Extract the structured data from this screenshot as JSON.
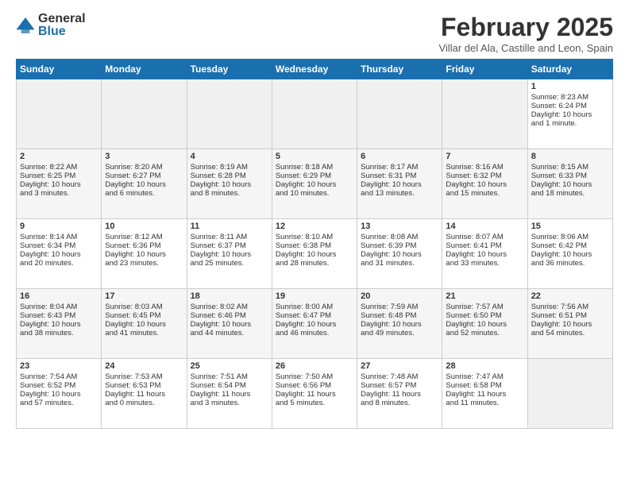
{
  "header": {
    "logo_general": "General",
    "logo_blue": "Blue",
    "month_year": "February 2025",
    "location": "Villar del Ala, Castille and Leon, Spain"
  },
  "days_of_week": [
    "Sunday",
    "Monday",
    "Tuesday",
    "Wednesday",
    "Thursday",
    "Friday",
    "Saturday"
  ],
  "weeks": [
    [
      {
        "day": "",
        "info": ""
      },
      {
        "day": "",
        "info": ""
      },
      {
        "day": "",
        "info": ""
      },
      {
        "day": "",
        "info": ""
      },
      {
        "day": "",
        "info": ""
      },
      {
        "day": "",
        "info": ""
      },
      {
        "day": "1",
        "info": "Sunrise: 8:23 AM\nSunset: 6:24 PM\nDaylight: 10 hours\nand 1 minute."
      }
    ],
    [
      {
        "day": "2",
        "info": "Sunrise: 8:22 AM\nSunset: 6:25 PM\nDaylight: 10 hours\nand 3 minutes."
      },
      {
        "day": "3",
        "info": "Sunrise: 8:20 AM\nSunset: 6:27 PM\nDaylight: 10 hours\nand 6 minutes."
      },
      {
        "day": "4",
        "info": "Sunrise: 8:19 AM\nSunset: 6:28 PM\nDaylight: 10 hours\nand 8 minutes."
      },
      {
        "day": "5",
        "info": "Sunrise: 8:18 AM\nSunset: 6:29 PM\nDaylight: 10 hours\nand 10 minutes."
      },
      {
        "day": "6",
        "info": "Sunrise: 8:17 AM\nSunset: 6:31 PM\nDaylight: 10 hours\nand 13 minutes."
      },
      {
        "day": "7",
        "info": "Sunrise: 8:16 AM\nSunset: 6:32 PM\nDaylight: 10 hours\nand 15 minutes."
      },
      {
        "day": "8",
        "info": "Sunrise: 8:15 AM\nSunset: 6:33 PM\nDaylight: 10 hours\nand 18 minutes."
      }
    ],
    [
      {
        "day": "9",
        "info": "Sunrise: 8:14 AM\nSunset: 6:34 PM\nDaylight: 10 hours\nand 20 minutes."
      },
      {
        "day": "10",
        "info": "Sunrise: 8:12 AM\nSunset: 6:36 PM\nDaylight: 10 hours\nand 23 minutes."
      },
      {
        "day": "11",
        "info": "Sunrise: 8:11 AM\nSunset: 6:37 PM\nDaylight: 10 hours\nand 25 minutes."
      },
      {
        "day": "12",
        "info": "Sunrise: 8:10 AM\nSunset: 6:38 PM\nDaylight: 10 hours\nand 28 minutes."
      },
      {
        "day": "13",
        "info": "Sunrise: 8:08 AM\nSunset: 6:39 PM\nDaylight: 10 hours\nand 31 minutes."
      },
      {
        "day": "14",
        "info": "Sunrise: 8:07 AM\nSunset: 6:41 PM\nDaylight: 10 hours\nand 33 minutes."
      },
      {
        "day": "15",
        "info": "Sunrise: 8:06 AM\nSunset: 6:42 PM\nDaylight: 10 hours\nand 36 minutes."
      }
    ],
    [
      {
        "day": "16",
        "info": "Sunrise: 8:04 AM\nSunset: 6:43 PM\nDaylight: 10 hours\nand 38 minutes."
      },
      {
        "day": "17",
        "info": "Sunrise: 8:03 AM\nSunset: 6:45 PM\nDaylight: 10 hours\nand 41 minutes."
      },
      {
        "day": "18",
        "info": "Sunrise: 8:02 AM\nSunset: 6:46 PM\nDaylight: 10 hours\nand 44 minutes."
      },
      {
        "day": "19",
        "info": "Sunrise: 8:00 AM\nSunset: 6:47 PM\nDaylight: 10 hours\nand 46 minutes."
      },
      {
        "day": "20",
        "info": "Sunrise: 7:59 AM\nSunset: 6:48 PM\nDaylight: 10 hours\nand 49 minutes."
      },
      {
        "day": "21",
        "info": "Sunrise: 7:57 AM\nSunset: 6:50 PM\nDaylight: 10 hours\nand 52 minutes."
      },
      {
        "day": "22",
        "info": "Sunrise: 7:56 AM\nSunset: 6:51 PM\nDaylight: 10 hours\nand 54 minutes."
      }
    ],
    [
      {
        "day": "23",
        "info": "Sunrise: 7:54 AM\nSunset: 6:52 PM\nDaylight: 10 hours\nand 57 minutes."
      },
      {
        "day": "24",
        "info": "Sunrise: 7:53 AM\nSunset: 6:53 PM\nDaylight: 11 hours\nand 0 minutes."
      },
      {
        "day": "25",
        "info": "Sunrise: 7:51 AM\nSunset: 6:54 PM\nDaylight: 11 hours\nand 3 minutes."
      },
      {
        "day": "26",
        "info": "Sunrise: 7:50 AM\nSunset: 6:56 PM\nDaylight: 11 hours\nand 5 minutes."
      },
      {
        "day": "27",
        "info": "Sunrise: 7:48 AM\nSunset: 6:57 PM\nDaylight: 11 hours\nand 8 minutes."
      },
      {
        "day": "28",
        "info": "Sunrise: 7:47 AM\nSunset: 6:58 PM\nDaylight: 11 hours\nand 11 minutes."
      },
      {
        "day": "",
        "info": ""
      }
    ]
  ]
}
